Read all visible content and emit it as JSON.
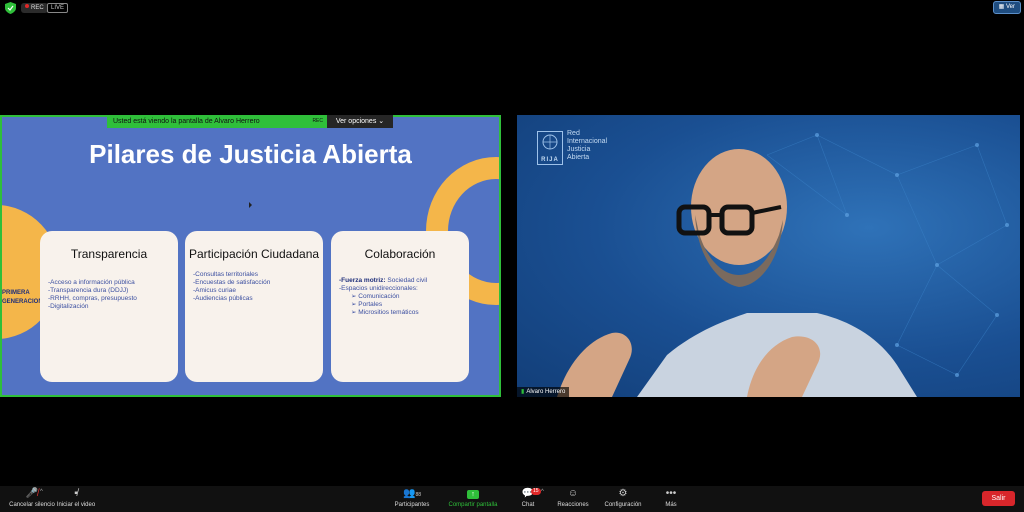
{
  "topbar": {
    "rec_label": "REC",
    "live_label": "LIVE",
    "view_label": "Ver"
  },
  "share": {
    "banner_text": "Usted está viendo la pantalla de Alvaro Herrero",
    "banner_rec": "REC",
    "options_label": "Ver opciones"
  },
  "slide": {
    "title": "Pilares de Justicia Abierta",
    "generation_label": "PRIMERA GENERACION",
    "cards": [
      {
        "title": "Transparencia",
        "items": [
          "-Acceso a información pública",
          "-Transparencia dura (DDJJ)",
          "-RRHH, compras, presupuesto",
          "-Digitalización"
        ]
      },
      {
        "title": "Participación Ciudadana",
        "items": [
          "-Consultas territoriales",
          "-Encuestas de satisfacción",
          "-Amicus curiae",
          "-Audiencias públicas"
        ]
      },
      {
        "title": "Colaboración",
        "items_bold_label": "-Fuerza motriz:",
        "items_bold_value": " Sociedad civil",
        "items_sub_header": "-Espacios unidireccionales:",
        "sub_items": [
          "➢  Comunicación",
          "➢  Portales",
          "➢  Micrositios temáticos"
        ]
      }
    ]
  },
  "video": {
    "logo_text": "RIJA",
    "org_lines": [
      "Red",
      "Internacional",
      "Justicia",
      "Abierta"
    ],
    "participant_name": "Alvaro Herrero"
  },
  "toolbar": {
    "mute_label": "Cancelar silencio",
    "video_label": "Iniciar el video",
    "participants_label": "Participantes",
    "participants_count": "88",
    "share_label": "Compartir pantalla",
    "chat_label": "Chat",
    "chat_badge": "15",
    "reactions_label": "Reacciones",
    "settings_label": "Configuración",
    "more_label": "Más",
    "leave_label": "Salir"
  },
  "colors": {
    "share_border": "#2fbf3a",
    "slide_bg": "#5273c3",
    "accent_ring": "#f4b64a",
    "leave_red": "#d8262b"
  }
}
